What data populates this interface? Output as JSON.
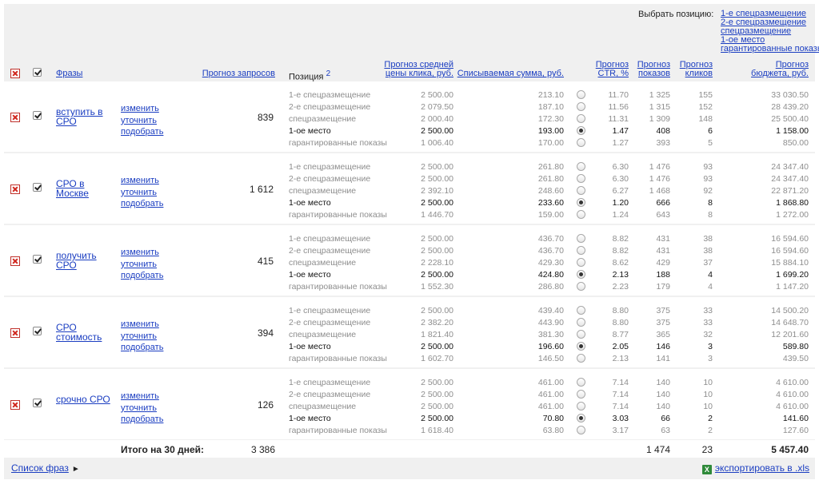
{
  "header": {
    "choose_label": "Выбрать позицию:",
    "choose_options": [
      "1-е спецразмещение",
      "2-е спецразмещение",
      "спецразмещение",
      "1-ое место",
      "гарантированные показы"
    ],
    "col_phrases": "Фразы",
    "col_queries": "Прогноз запросов",
    "col_position": "Позиция",
    "col_position_sup": "2",
    "col_avg_price_1": "Прогноз средней",
    "col_avg_price_2": "цены клика, руб.",
    "col_amount": "Списываемая сумма, руб.",
    "col_ctr_1": "Прогноз",
    "col_ctr_2": "CTR, %",
    "col_shows_1": "Прогноз",
    "col_shows_2": "показов",
    "col_clicks_1": "Прогноз",
    "col_clicks_2": "кликов",
    "col_budget_1": "Прогноз",
    "col_budget_2": "бюджета, руб."
  },
  "action_labels": [
    "изменить",
    "уточнить",
    "подобрать"
  ],
  "groups": [
    {
      "phrase": "вступить в СРО",
      "queries": "839",
      "rows": [
        {
          "pos": "1-е спецразмещение",
          "price": "2 500.00",
          "amount": "213.10",
          "selected": false,
          "ctr": "11.70",
          "shows": "1 325",
          "clicks": "155",
          "budget": "33 030.50"
        },
        {
          "pos": "2-е спецразмещение",
          "price": "2 079.50",
          "amount": "187.10",
          "selected": false,
          "ctr": "11.56",
          "shows": "1 315",
          "clicks": "152",
          "budget": "28 439.20"
        },
        {
          "pos": "спецразмещение",
          "price": "2 000.40",
          "amount": "172.30",
          "selected": false,
          "ctr": "11.31",
          "shows": "1 309",
          "clicks": "148",
          "budget": "25 500.40"
        },
        {
          "pos": "1-ое место",
          "price": "2 500.00",
          "amount": "193.00",
          "selected": true,
          "ctr": "1.47",
          "shows": "408",
          "clicks": "6",
          "budget": "1 158.00"
        },
        {
          "pos": "гарантированные показы",
          "price": "1 006.40",
          "amount": "170.00",
          "selected": false,
          "ctr": "1.27",
          "shows": "393",
          "clicks": "5",
          "budget": "850.00"
        }
      ]
    },
    {
      "phrase": "СРО в Москве",
      "queries": "1 612",
      "rows": [
        {
          "pos": "1-е спецразмещение",
          "price": "2 500.00",
          "amount": "261.80",
          "selected": false,
          "ctr": "6.30",
          "shows": "1 476",
          "clicks": "93",
          "budget": "24 347.40"
        },
        {
          "pos": "2-е спецразмещение",
          "price": "2 500.00",
          "amount": "261.80",
          "selected": false,
          "ctr": "6.30",
          "shows": "1 476",
          "clicks": "93",
          "budget": "24 347.40"
        },
        {
          "pos": "спецразмещение",
          "price": "2 392.10",
          "amount": "248.60",
          "selected": false,
          "ctr": "6.27",
          "shows": "1 468",
          "clicks": "92",
          "budget": "22 871.20"
        },
        {
          "pos": "1-ое место",
          "price": "2 500.00",
          "amount": "233.60",
          "selected": true,
          "ctr": "1.20",
          "shows": "666",
          "clicks": "8",
          "budget": "1 868.80"
        },
        {
          "pos": "гарантированные показы",
          "price": "1 446.70",
          "amount": "159.00",
          "selected": false,
          "ctr": "1.24",
          "shows": "643",
          "clicks": "8",
          "budget": "1 272.00"
        }
      ]
    },
    {
      "phrase": "получить СРО",
      "queries": "415",
      "rows": [
        {
          "pos": "1-е спецразмещение",
          "price": "2 500.00",
          "amount": "436.70",
          "selected": false,
          "ctr": "8.82",
          "shows": "431",
          "clicks": "38",
          "budget": "16 594.60"
        },
        {
          "pos": "2-е спецразмещение",
          "price": "2 500.00",
          "amount": "436.70",
          "selected": false,
          "ctr": "8.82",
          "shows": "431",
          "clicks": "38",
          "budget": "16 594.60"
        },
        {
          "pos": "спецразмещение",
          "price": "2 228.10",
          "amount": "429.30",
          "selected": false,
          "ctr": "8.62",
          "shows": "429",
          "clicks": "37",
          "budget": "15 884.10"
        },
        {
          "pos": "1-ое место",
          "price": "2 500.00",
          "amount": "424.80",
          "selected": true,
          "ctr": "2.13",
          "shows": "188",
          "clicks": "4",
          "budget": "1 699.20"
        },
        {
          "pos": "гарантированные показы",
          "price": "1 552.30",
          "amount": "286.80",
          "selected": false,
          "ctr": "2.23",
          "shows": "179",
          "clicks": "4",
          "budget": "1 147.20"
        }
      ]
    },
    {
      "phrase": "СРО стоимость",
      "queries": "394",
      "rows": [
        {
          "pos": "1-е спецразмещение",
          "price": "2 500.00",
          "amount": "439.40",
          "selected": false,
          "ctr": "8.80",
          "shows": "375",
          "clicks": "33",
          "budget": "14 500.20"
        },
        {
          "pos": "2-е спецразмещение",
          "price": "2 382.20",
          "amount": "443.90",
          "selected": false,
          "ctr": "8.80",
          "shows": "375",
          "clicks": "33",
          "budget": "14 648.70"
        },
        {
          "pos": "спецразмещение",
          "price": "1 821.40",
          "amount": "381.30",
          "selected": false,
          "ctr": "8.77",
          "shows": "365",
          "clicks": "32",
          "budget": "12 201.60"
        },
        {
          "pos": "1-ое место",
          "price": "2 500.00",
          "amount": "196.60",
          "selected": true,
          "ctr": "2.05",
          "shows": "146",
          "clicks": "3",
          "budget": "589.80"
        },
        {
          "pos": "гарантированные показы",
          "price": "1 602.70",
          "amount": "146.50",
          "selected": false,
          "ctr": "2.13",
          "shows": "141",
          "clicks": "3",
          "budget": "439.50"
        }
      ]
    },
    {
      "phrase": "срочно СРО",
      "queries": "126",
      "rows": [
        {
          "pos": "1-е спецразмещение",
          "price": "2 500.00",
          "amount": "461.00",
          "selected": false,
          "ctr": "7.14",
          "shows": "140",
          "clicks": "10",
          "budget": "4 610.00"
        },
        {
          "pos": "2-е спецразмещение",
          "price": "2 500.00",
          "amount": "461.00",
          "selected": false,
          "ctr": "7.14",
          "shows": "140",
          "clicks": "10",
          "budget": "4 610.00"
        },
        {
          "pos": "спецразмещение",
          "price": "2 500.00",
          "amount": "461.00",
          "selected": false,
          "ctr": "7.14",
          "shows": "140",
          "clicks": "10",
          "budget": "4 610.00"
        },
        {
          "pos": "1-ое место",
          "price": "2 500.00",
          "amount": "70.80",
          "selected": true,
          "ctr": "3.03",
          "shows": "66",
          "clicks": "2",
          "budget": "141.60"
        },
        {
          "pos": "гарантированные показы",
          "price": "1 618.40",
          "amount": "63.80",
          "selected": false,
          "ctr": "3.17",
          "shows": "63",
          "clicks": "2",
          "budget": "127.60"
        }
      ]
    }
  ],
  "total": {
    "label": "Итого на 30 дней:",
    "queries": "3 386",
    "shows": "1 474",
    "clicks": "23",
    "budget": "5 457.40"
  },
  "footer": {
    "phrase_list": "Список фраз",
    "phrase_list_arrow": "►",
    "export": "экспортировать в .xls",
    "export_icon_glyph": "X"
  },
  "colors": {
    "link": "#1a3dc1",
    "panel_bg": "#f0f0f0",
    "delete_red": "#d0261d"
  }
}
